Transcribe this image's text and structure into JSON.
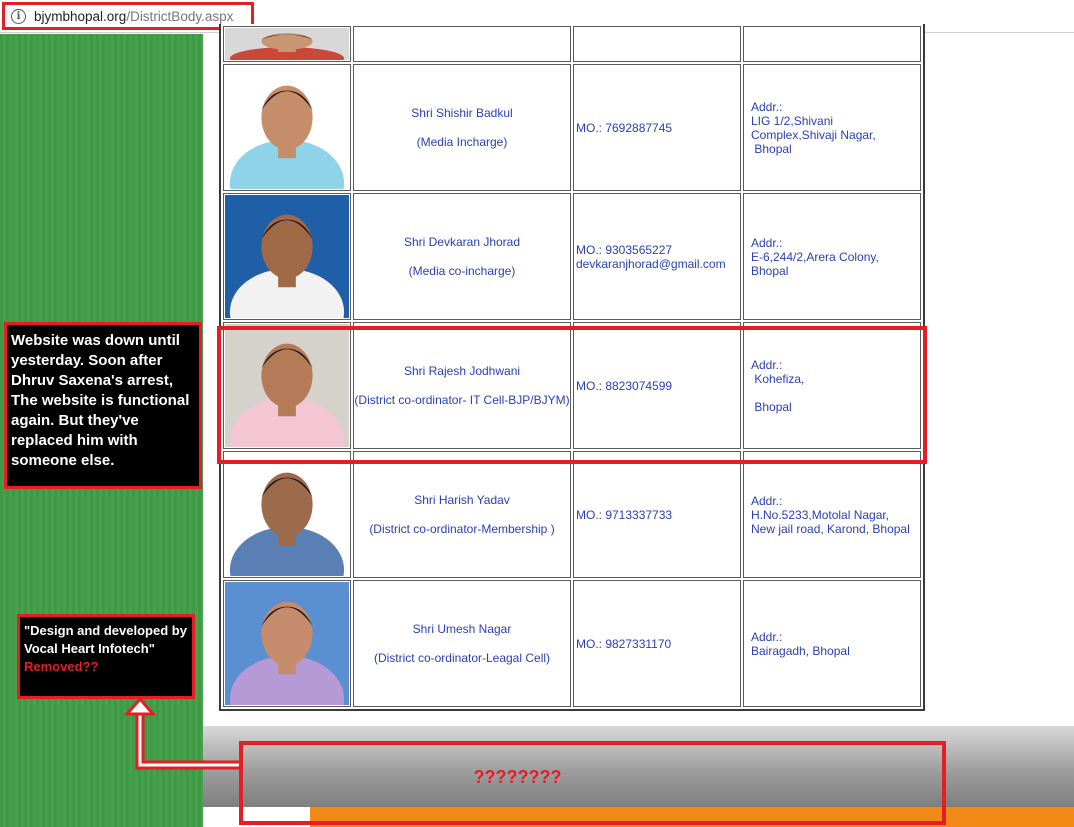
{
  "browser": {
    "url_domain": "bjymbhopal.org",
    "url_path": "/DistrictBody.aspx",
    "info_icon": "info-circle-icon"
  },
  "rows": [
    {
      "name": "",
      "role": "",
      "phone": "",
      "email": "",
      "addr": "",
      "photo": "portrait-photo"
    },
    {
      "name": "Shri Shishir Badkul",
      "role": "(Media Incharge)",
      "phone": "MO.:  7692887745",
      "email": "",
      "addr": "Addr.:\nLIG 1/2,Shivani Complex,Shivaji Nagar,\n Bhopal",
      "photo": "portrait-photo"
    },
    {
      "name": "Shri Devkaran Jhorad",
      "role": "(Media co-incharge)",
      "phone": "MO.:  9303565227",
      "email": "devkaranjhorad@gmail.com",
      "addr": "Addr.:\nE-6,244/2,Arera Colony,\nBhopal",
      "photo": "portrait-photo"
    },
    {
      "name": "Shri Rajesh Jodhwani",
      "role": "(District co-ordinator- IT Cell-BJP/BJYM)",
      "phone": "MO.:  8823074599",
      "email": "",
      "addr": "Addr.:\n Kohefiza,\n\n Bhopal",
      "photo": "portrait-photo"
    },
    {
      "name": "Shri Harish Yadav",
      "role": "(District co-ordinator-Membership )",
      "phone": "MO.:  9713337733",
      "email": "",
      "addr": "Addr.:\nH.No.5233,Motolal Nagar,\nNew jail road, Karond, Bhopal",
      "photo": "portrait-photo"
    },
    {
      "name": "Shri Umesh Nagar",
      "role": "(District co-ordinator-Leagal Cell)",
      "phone": "MO.:  9827331170",
      "email": "",
      "addr": "Addr.:\nBairagadh, Bhopal",
      "photo": "portrait-photo"
    }
  ],
  "annotations": {
    "down_note": "Website was down until yesterday. Soon after Dhruv Saxena's arrest, The website is functional again. But they've replaced him with someone else.",
    "design_note": "\"Design and developed by Vocal Heart Infotech\"",
    "design_note_red": "Removed??",
    "question": "????????"
  },
  "colors": {
    "annotation_red": "#e31e24",
    "link_blue": "#2a3fb3",
    "green": "#3f9a45",
    "orange": "#f28a16"
  }
}
